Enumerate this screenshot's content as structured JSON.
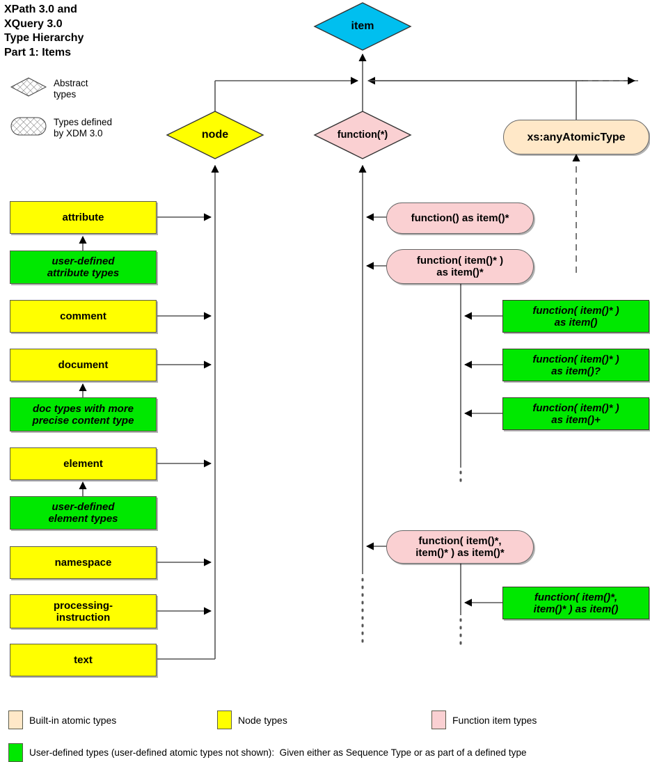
{
  "title": "XPath 3.0 and\nXQuery 3.0\nType Hierarchy\nPart 1: Items",
  "key": {
    "abstract_types": "Abstract\ntypes",
    "xdm_types": "Types defined\nby XDM 3.0"
  },
  "colors": {
    "item": "#00bfef",
    "node_type": "#ffff00",
    "function_item_type": "#fad0d2",
    "builtin_atomic_type": "#ffe8c8",
    "user_defined_type": "#00e800",
    "line": "#555555",
    "text": "#000000",
    "background": "#ffffff"
  },
  "roots": {
    "item": "item",
    "node": "node",
    "function_star": "function(*)",
    "any_atomic": "xs:anyAtomicType"
  },
  "node_types": [
    {
      "label": "attribute",
      "kind": "node"
    },
    {
      "label": "user-defined\nattribute types",
      "kind": "user-defined"
    },
    {
      "label": "comment",
      "kind": "node"
    },
    {
      "label": "document",
      "kind": "node"
    },
    {
      "label": "doc types with more\nprecise content type",
      "kind": "user-defined"
    },
    {
      "label": "element",
      "kind": "node"
    },
    {
      "label": "user-defined\nelement types",
      "kind": "user-defined"
    },
    {
      "label": "namespace",
      "kind": "node"
    },
    {
      "label": "processing-\ninstruction",
      "kind": "node"
    },
    {
      "label": "text",
      "kind": "node"
    }
  ],
  "function_types": [
    {
      "label": "function() as item()*",
      "kind": "function-item"
    },
    {
      "label": "function( item()* )\nas item()*",
      "kind": "function-item"
    },
    {
      "label": "function( item()* )\nas item()",
      "kind": "user-defined"
    },
    {
      "label": "function( item()* )\nas item()?",
      "kind": "user-defined"
    },
    {
      "label": "function( item()* )\nas item()+",
      "kind": "user-defined"
    },
    {
      "label": "function( item()*,\nitem()* ) as item()*",
      "kind": "function-item"
    },
    {
      "label": "function( item()*,\nitem()* ) as item()",
      "kind": "user-defined"
    }
  ],
  "legend": [
    {
      "label": "Built-in atomic types",
      "color": "#ffe8c8"
    },
    {
      "label": "Node types",
      "color": "#ffff00"
    },
    {
      "label": "Function item types",
      "color": "#fad0d2"
    },
    {
      "label": "User-defined types (user-defined atomic types not shown):  Given either as Sequence Type or as part of a defined type",
      "color": "#00e800"
    }
  ]
}
